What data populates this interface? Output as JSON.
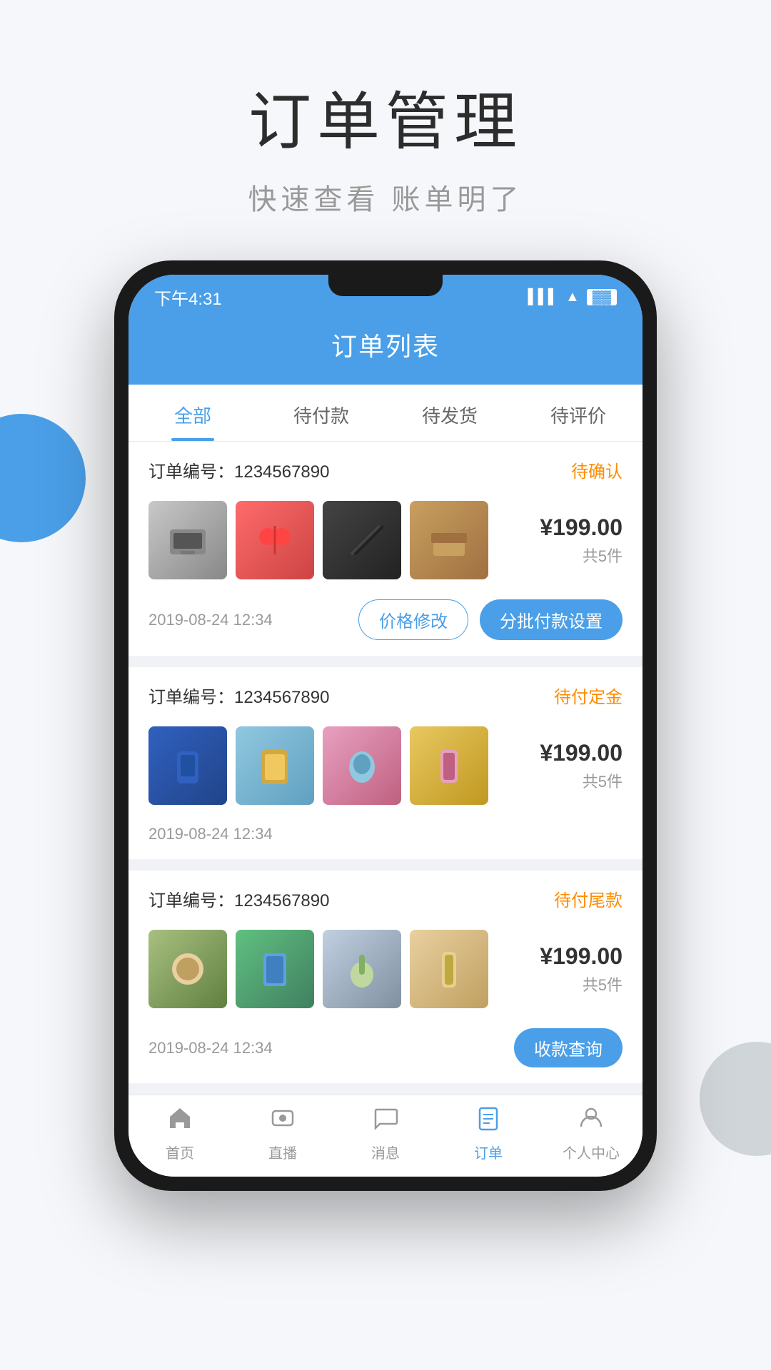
{
  "page": {
    "background_title": "订单管理",
    "background_subtitle": "快速查看  账单明了"
  },
  "app": {
    "status_time": "下午4:31",
    "header_title": "订单列表"
  },
  "tabs": [
    {
      "id": "all",
      "label": "全部",
      "active": true
    },
    {
      "id": "pending_pay",
      "label": "待付款",
      "active": false
    },
    {
      "id": "pending_ship",
      "label": "待发货",
      "active": false
    },
    {
      "id": "pending_review",
      "label": "待评价",
      "active": false
    }
  ],
  "orders": [
    {
      "id": "order-1",
      "number_label": "订单编号：",
      "number": "1234567890",
      "status": "待确认",
      "price": "¥199.00",
      "count": "共5件",
      "date": "2019-08-24 12:34",
      "actions": [
        {
          "id": "price-modify",
          "label": "价格修改",
          "type": "outline"
        },
        {
          "id": "batch-pay",
          "label": "分批付款设置",
          "type": "primary"
        }
      ],
      "products": [
        "🖨",
        "🎐",
        "✏️",
        "🛋️"
      ]
    },
    {
      "id": "order-2",
      "number_label": "订单编号：",
      "number": "1234567890",
      "status": "待付定金",
      "price": "¥199.00",
      "count": "共5件",
      "date": "2019-08-24 12:34",
      "actions": [],
      "products": [
        "🥤",
        "🍵",
        "🧴",
        "💊"
      ]
    },
    {
      "id": "order-3",
      "number_label": "订单编号：",
      "number": "1234567890",
      "status": "待付尾款",
      "price": "¥199.00",
      "count": "共5件",
      "date": "2019-08-24 12:34",
      "actions": [
        {
          "id": "payment-query",
          "label": "收款查询",
          "type": "primary"
        }
      ],
      "products": [
        "🍪",
        "🧴",
        "💚",
        "✨"
      ]
    }
  ],
  "bottom_nav": [
    {
      "id": "home",
      "label": "首页",
      "active": false
    },
    {
      "id": "live",
      "label": "直播",
      "active": false
    },
    {
      "id": "message",
      "label": "消息",
      "active": false
    },
    {
      "id": "order",
      "label": "订单",
      "active": true
    },
    {
      "id": "profile",
      "label": "个人中心",
      "active": false
    }
  ]
}
